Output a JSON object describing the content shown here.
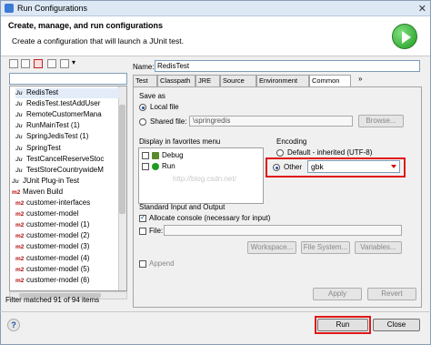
{
  "window": {
    "title": "Run Configurations"
  },
  "header": {
    "title": "Create, manage, and run configurations",
    "subtitle": "Create a configuration that will launch a JUnit test."
  },
  "tree": {
    "items": [
      {
        "label": "RedisTest",
        "icon": "junit-icon"
      },
      {
        "label": "RedisTest.testAddUser",
        "icon": "junit-icon"
      },
      {
        "label": "RemoteCustomerMana",
        "icon": "junit-icon"
      },
      {
        "label": "RunMainTest (1)",
        "icon": "junit-icon"
      },
      {
        "label": "SpringJedisTest (1)",
        "icon": "junit-icon"
      },
      {
        "label": "SpringTest",
        "icon": "junit-icon"
      },
      {
        "label": "TestCancelReserveStoc",
        "icon": "junit-icon"
      },
      {
        "label": "TestStoreCountrywideM",
        "icon": "junit-icon"
      },
      {
        "label": "JUnit Plug-in Test",
        "icon": "junit-plugin-icon"
      },
      {
        "label": "Maven Build",
        "icon": "maven-icon"
      },
      {
        "label": "customer-interfaces",
        "icon": "maven-icon"
      },
      {
        "label": "customer-model",
        "icon": "maven-icon"
      },
      {
        "label": "customer-model (1)",
        "icon": "maven-icon"
      },
      {
        "label": "customer-model (2)",
        "icon": "maven-icon"
      },
      {
        "label": "customer-model (3)",
        "icon": "maven-icon"
      },
      {
        "label": "customer-model (4)",
        "icon": "maven-icon"
      },
      {
        "label": "customer-model (5)",
        "icon": "maven-icon"
      },
      {
        "label": "customer-model (6)",
        "icon": "maven-icon"
      }
    ],
    "icon_text": {
      "junit": "Ju",
      "maven": "m2"
    },
    "filter_status": "Filter matched 91 of 94 items"
  },
  "name": {
    "label": "Name:",
    "value": "RedisTest"
  },
  "tabs": [
    "Test",
    "Classpath",
    "JRE",
    "Source",
    "Environment",
    "Common"
  ],
  "tab_overflow": "»",
  "save_as": {
    "label": "Save as",
    "local_file": "Local file",
    "shared_file": "Shared file:",
    "shared_value": "\\springredis",
    "browse": "Browse..."
  },
  "favorites": {
    "label": "Display in favorites menu",
    "items": [
      "Debug",
      "Run"
    ]
  },
  "encoding": {
    "label": "Encoding",
    "default": "Default - inherited (UTF-8)",
    "other": "Other",
    "other_value": "gbk"
  },
  "watermark": "http://blog.csdn.net/",
  "std_io": {
    "label": "Standard Input and Output",
    "allocate_console": "Allocate console (necessary for input)",
    "file": "File:",
    "workspace": "Workspace...",
    "file_system": "File System...",
    "variables": "Variables...",
    "append": "Append"
  },
  "buttons": {
    "apply": "Apply",
    "revert": "Revert",
    "run": "Run",
    "close": "Close"
  },
  "colors": {
    "highlight": "#e01818",
    "run_green": "#1e9b1e"
  }
}
